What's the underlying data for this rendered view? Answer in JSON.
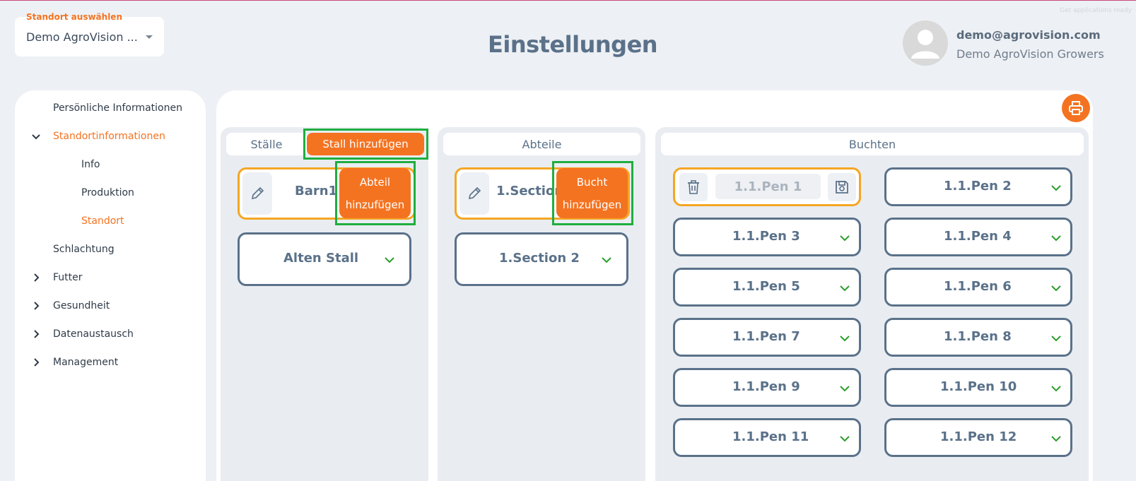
{
  "header": {
    "location_label": "Standort auswählen",
    "location_value": "Demo AgroVision ...",
    "page_title": "Einstellungen",
    "user_email": "demo@agrovision.com",
    "user_org": "Demo AgroVision Growers",
    "watermark": "Get applications ready"
  },
  "sidebar": {
    "personal": "Persönliche Informationen",
    "site_info": "Standortinformationen",
    "info": "Info",
    "production": "Produktion",
    "location": "Standort",
    "slaughter": "Schlachtung",
    "feed": "Futter",
    "health": "Gesundheit",
    "data_exchange": "Datenaustausch",
    "management": "Management"
  },
  "barns": {
    "header": "Ställe",
    "add_button": "Stall hinzufügen",
    "selected": "Barn1",
    "add_section_line1": "Abteil",
    "add_section_line2": "hinzufügen",
    "other": "Alten Stall"
  },
  "sections": {
    "header": "Abteile",
    "selected": "1.Section",
    "add_pen_line1": "Bucht",
    "add_pen_line2": "hinzufügen",
    "other": "1.Section 2"
  },
  "pens": {
    "header": "Buchten",
    "editing_value": "1.1.Pen 1",
    "items": [
      "1.1.Pen 2",
      "1.1.Pen 3",
      "1.1.Pen 4",
      "1.1.Pen 5",
      "1.1.Pen 6",
      "1.1.Pen 7",
      "1.1.Pen 8",
      "1.1.Pen 9",
      "1.1.Pen 10",
      "1.1.Pen 11",
      "1.1.Pen 12"
    ]
  },
  "colors": {
    "accent": "#f47321",
    "highlight_frame": "#1fae3f",
    "selected_border": "#f5a623",
    "card_border": "#5a7189"
  }
}
